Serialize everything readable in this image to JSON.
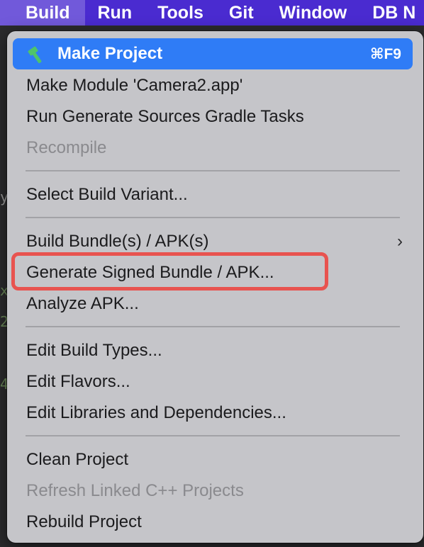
{
  "menubar": {
    "items": [
      {
        "label": "Build",
        "active": true
      },
      {
        "label": "Run"
      },
      {
        "label": "Tools"
      },
      {
        "label": "Git"
      },
      {
        "label": "Window"
      },
      {
        "label": "DB N"
      }
    ]
  },
  "background": {
    "glyphs": [
      "x",
      "2",
      "4",
      "y"
    ]
  },
  "build_menu": {
    "make_project": {
      "label": "Make Project",
      "shortcut": "⌘F9",
      "icon": "hammer-icon"
    },
    "make_module": "Make Module 'Camera2.app'",
    "run_generate_sources": "Run Generate Sources Gradle Tasks",
    "recompile": "Recompile",
    "select_build_variant": "Select Build Variant...",
    "build_bundles": "Build Bundle(s) / APK(s)",
    "submenu_arrow": "›",
    "generate_signed": "Generate Signed Bundle / APK...",
    "analyze_apk": "Analyze APK...",
    "edit_build_types": "Edit Build Types...",
    "edit_flavors": "Edit Flavors...",
    "edit_libraries": "Edit Libraries and Dependencies...",
    "clean_project": "Clean Project",
    "refresh_linked": "Refresh Linked C++ Projects",
    "rebuild_project": "Rebuild Project"
  },
  "colors": {
    "menubar_bg": "#4a2bd0",
    "menu_bg": "#c5c5c9",
    "highlight": "#2f7cf6",
    "annotation": "#e8534f",
    "hammer_icon": "#4fc46a"
  }
}
